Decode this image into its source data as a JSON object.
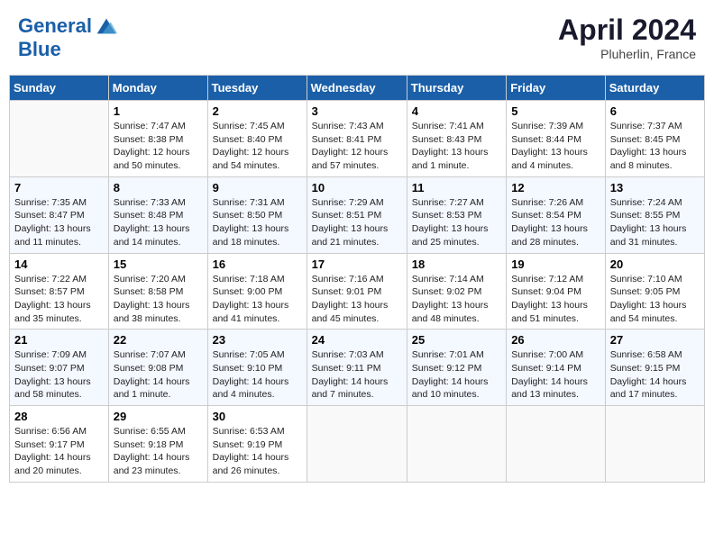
{
  "header": {
    "logo_line1": "General",
    "logo_line2": "Blue",
    "month": "April 2024",
    "location": "Pluherlin, France"
  },
  "columns": [
    "Sunday",
    "Monday",
    "Tuesday",
    "Wednesday",
    "Thursday",
    "Friday",
    "Saturday"
  ],
  "weeks": [
    [
      {
        "day": "",
        "info": ""
      },
      {
        "day": "1",
        "info": "Sunrise: 7:47 AM\nSunset: 8:38 PM\nDaylight: 12 hours\nand 50 minutes."
      },
      {
        "day": "2",
        "info": "Sunrise: 7:45 AM\nSunset: 8:40 PM\nDaylight: 12 hours\nand 54 minutes."
      },
      {
        "day": "3",
        "info": "Sunrise: 7:43 AM\nSunset: 8:41 PM\nDaylight: 12 hours\nand 57 minutes."
      },
      {
        "day": "4",
        "info": "Sunrise: 7:41 AM\nSunset: 8:43 PM\nDaylight: 13 hours\nand 1 minute."
      },
      {
        "day": "5",
        "info": "Sunrise: 7:39 AM\nSunset: 8:44 PM\nDaylight: 13 hours\nand 4 minutes."
      },
      {
        "day": "6",
        "info": "Sunrise: 7:37 AM\nSunset: 8:45 PM\nDaylight: 13 hours\nand 8 minutes."
      }
    ],
    [
      {
        "day": "7",
        "info": "Sunrise: 7:35 AM\nSunset: 8:47 PM\nDaylight: 13 hours\nand 11 minutes."
      },
      {
        "day": "8",
        "info": "Sunrise: 7:33 AM\nSunset: 8:48 PM\nDaylight: 13 hours\nand 14 minutes."
      },
      {
        "day": "9",
        "info": "Sunrise: 7:31 AM\nSunset: 8:50 PM\nDaylight: 13 hours\nand 18 minutes."
      },
      {
        "day": "10",
        "info": "Sunrise: 7:29 AM\nSunset: 8:51 PM\nDaylight: 13 hours\nand 21 minutes."
      },
      {
        "day": "11",
        "info": "Sunrise: 7:27 AM\nSunset: 8:53 PM\nDaylight: 13 hours\nand 25 minutes."
      },
      {
        "day": "12",
        "info": "Sunrise: 7:26 AM\nSunset: 8:54 PM\nDaylight: 13 hours\nand 28 minutes."
      },
      {
        "day": "13",
        "info": "Sunrise: 7:24 AM\nSunset: 8:55 PM\nDaylight: 13 hours\nand 31 minutes."
      }
    ],
    [
      {
        "day": "14",
        "info": "Sunrise: 7:22 AM\nSunset: 8:57 PM\nDaylight: 13 hours\nand 35 minutes."
      },
      {
        "day": "15",
        "info": "Sunrise: 7:20 AM\nSunset: 8:58 PM\nDaylight: 13 hours\nand 38 minutes."
      },
      {
        "day": "16",
        "info": "Sunrise: 7:18 AM\nSunset: 9:00 PM\nDaylight: 13 hours\nand 41 minutes."
      },
      {
        "day": "17",
        "info": "Sunrise: 7:16 AM\nSunset: 9:01 PM\nDaylight: 13 hours\nand 45 minutes."
      },
      {
        "day": "18",
        "info": "Sunrise: 7:14 AM\nSunset: 9:02 PM\nDaylight: 13 hours\nand 48 minutes."
      },
      {
        "day": "19",
        "info": "Sunrise: 7:12 AM\nSunset: 9:04 PM\nDaylight: 13 hours\nand 51 minutes."
      },
      {
        "day": "20",
        "info": "Sunrise: 7:10 AM\nSunset: 9:05 PM\nDaylight: 13 hours\nand 54 minutes."
      }
    ],
    [
      {
        "day": "21",
        "info": "Sunrise: 7:09 AM\nSunset: 9:07 PM\nDaylight: 13 hours\nand 58 minutes."
      },
      {
        "day": "22",
        "info": "Sunrise: 7:07 AM\nSunset: 9:08 PM\nDaylight: 14 hours\nand 1 minute."
      },
      {
        "day": "23",
        "info": "Sunrise: 7:05 AM\nSunset: 9:10 PM\nDaylight: 14 hours\nand 4 minutes."
      },
      {
        "day": "24",
        "info": "Sunrise: 7:03 AM\nSunset: 9:11 PM\nDaylight: 14 hours\nand 7 minutes."
      },
      {
        "day": "25",
        "info": "Sunrise: 7:01 AM\nSunset: 9:12 PM\nDaylight: 14 hours\nand 10 minutes."
      },
      {
        "day": "26",
        "info": "Sunrise: 7:00 AM\nSunset: 9:14 PM\nDaylight: 14 hours\nand 13 minutes."
      },
      {
        "day": "27",
        "info": "Sunrise: 6:58 AM\nSunset: 9:15 PM\nDaylight: 14 hours\nand 17 minutes."
      }
    ],
    [
      {
        "day": "28",
        "info": "Sunrise: 6:56 AM\nSunset: 9:17 PM\nDaylight: 14 hours\nand 20 minutes."
      },
      {
        "day": "29",
        "info": "Sunrise: 6:55 AM\nSunset: 9:18 PM\nDaylight: 14 hours\nand 23 minutes."
      },
      {
        "day": "30",
        "info": "Sunrise: 6:53 AM\nSunset: 9:19 PM\nDaylight: 14 hours\nand 26 minutes."
      },
      {
        "day": "",
        "info": ""
      },
      {
        "day": "",
        "info": ""
      },
      {
        "day": "",
        "info": ""
      },
      {
        "day": "",
        "info": ""
      }
    ]
  ]
}
